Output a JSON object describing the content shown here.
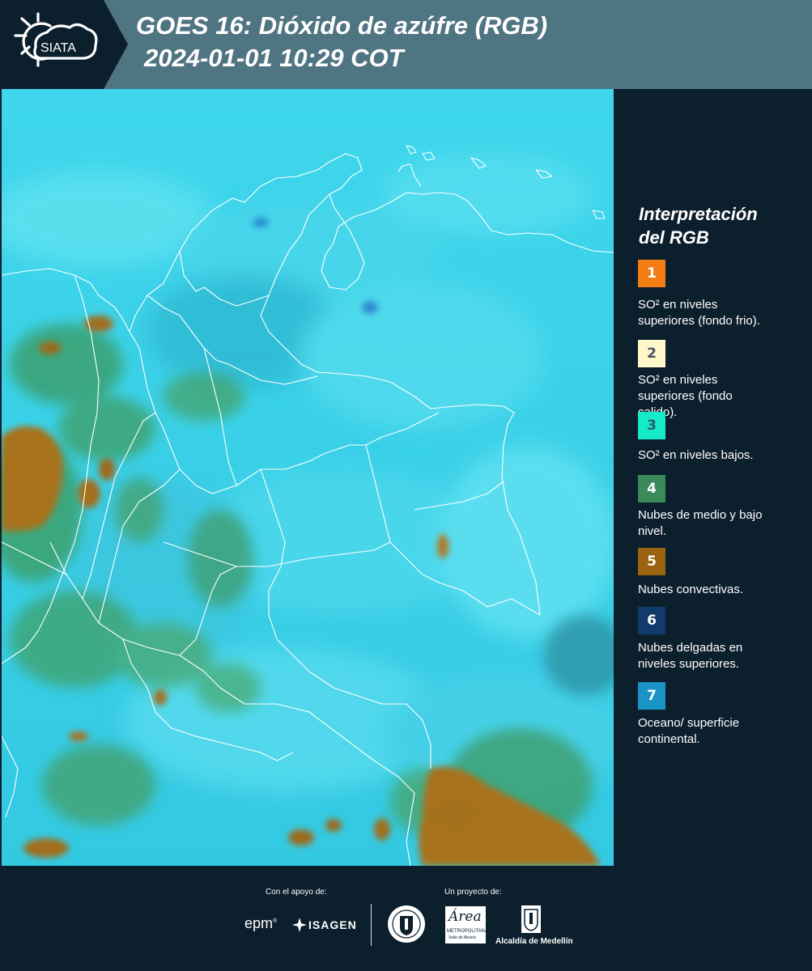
{
  "header": {
    "logo_text": "SIATA",
    "title_line1": "GOES 16: Dióxido de azúfre (RGB)",
    "title_line2": "2024-01-01 10:29 COT"
  },
  "legend": {
    "title_line1": "Interpretación",
    "title_line2": "del RGB",
    "items": [
      {
        "number": "1",
        "color": "#f47c14",
        "text_color": "#ffffff",
        "line1": "SO² en niveles",
        "line2": "superiores (fondo frio)."
      },
      {
        "number": "2",
        "color": "#fff8c8",
        "text_color": "#44506a",
        "line1": "SO² en niveles",
        "line2": "superiores (fondo",
        "line3": "calido)."
      },
      {
        "number": "3",
        "color": "#17eac8",
        "text_color": "#2a5a70",
        "line1": "SO² en niveles bajos."
      },
      {
        "number": "4",
        "color": "#3a8a5a",
        "text_color": "#ffffff",
        "line1": "Nubes de medio y bajo",
        "line2": "nivel."
      },
      {
        "number": "5",
        "color": "#9a6310",
        "text_color": "#ffffff",
        "line1": "Nubes convectivas."
      },
      {
        "number": "6",
        "color": "#123a6a",
        "text_color": "#ffffff",
        "line1": "Nubes delgadas en",
        "line2": "niveles superiores."
      },
      {
        "number": "7",
        "color": "#1a94c4",
        "text_color": "#ffffff",
        "line1": "Oceano/ superficie",
        "line2": "continental."
      }
    ]
  },
  "footer": {
    "support_label": "Con el apoyo de:",
    "project_label": "Un proyecto de:",
    "epm": "epm",
    "isagen": "ISAGEN",
    "area": "Área",
    "area_sub1": "METROPOLITANA",
    "area_sub2": "Valle de Aburrá",
    "alcaldia": "Alcaldía de Medellín"
  },
  "colors": {
    "background": "#0c1f2c",
    "header": "#4f7482",
    "map_base": "#2ccde4"
  }
}
